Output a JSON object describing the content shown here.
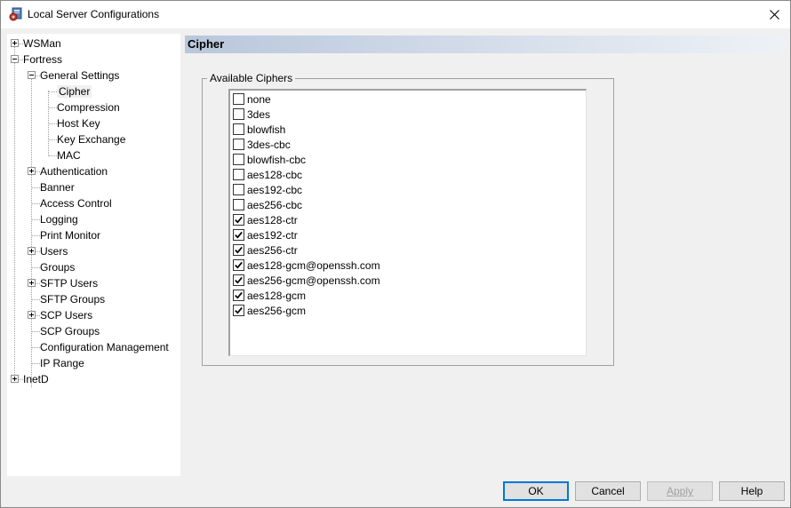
{
  "window": {
    "title": "Local Server Configurations"
  },
  "tree": {
    "items": [
      {
        "label": "WSMan"
      },
      {
        "label": "Fortress"
      },
      {
        "label": "General Settings"
      },
      {
        "label": "Cipher"
      },
      {
        "label": "Compression"
      },
      {
        "label": "Host Key"
      },
      {
        "label": "Key Exchange"
      },
      {
        "label": "MAC"
      },
      {
        "label": "Authentication"
      },
      {
        "label": "Banner"
      },
      {
        "label": "Access Control"
      },
      {
        "label": "Logging"
      },
      {
        "label": "Print Monitor"
      },
      {
        "label": "Users"
      },
      {
        "label": "Groups"
      },
      {
        "label": "SFTP Users"
      },
      {
        "label": "SFTP Groups"
      },
      {
        "label": "SCP Users"
      },
      {
        "label": "SCP Groups"
      },
      {
        "label": "Configuration Management"
      },
      {
        "label": "IP Range"
      },
      {
        "label": "InetD"
      }
    ],
    "selected": "Cipher"
  },
  "panel": {
    "header": "Cipher",
    "group_label": "Available Ciphers",
    "ciphers": [
      {
        "name": "none",
        "checked": false
      },
      {
        "name": "3des",
        "checked": false
      },
      {
        "name": "blowfish",
        "checked": false
      },
      {
        "name": "3des-cbc",
        "checked": false
      },
      {
        "name": "blowfish-cbc",
        "checked": false
      },
      {
        "name": "aes128-cbc",
        "checked": false
      },
      {
        "name": "aes192-cbc",
        "checked": false
      },
      {
        "name": "aes256-cbc",
        "checked": false
      },
      {
        "name": "aes128-ctr",
        "checked": true
      },
      {
        "name": "aes192-ctr",
        "checked": true
      },
      {
        "name": "aes256-ctr",
        "checked": true
      },
      {
        "name": "aes128-gcm@openssh.com",
        "checked": true
      },
      {
        "name": "aes256-gcm@openssh.com",
        "checked": true
      },
      {
        "name": "aes128-gcm",
        "checked": true
      },
      {
        "name": "aes256-gcm",
        "checked": true
      }
    ]
  },
  "buttons": {
    "ok": "OK",
    "cancel": "Cancel",
    "apply": "Apply",
    "help": "Help"
  },
  "colors": {
    "header_gradient_start": "#b9c7dc",
    "default_button_border": "#0078d7"
  }
}
